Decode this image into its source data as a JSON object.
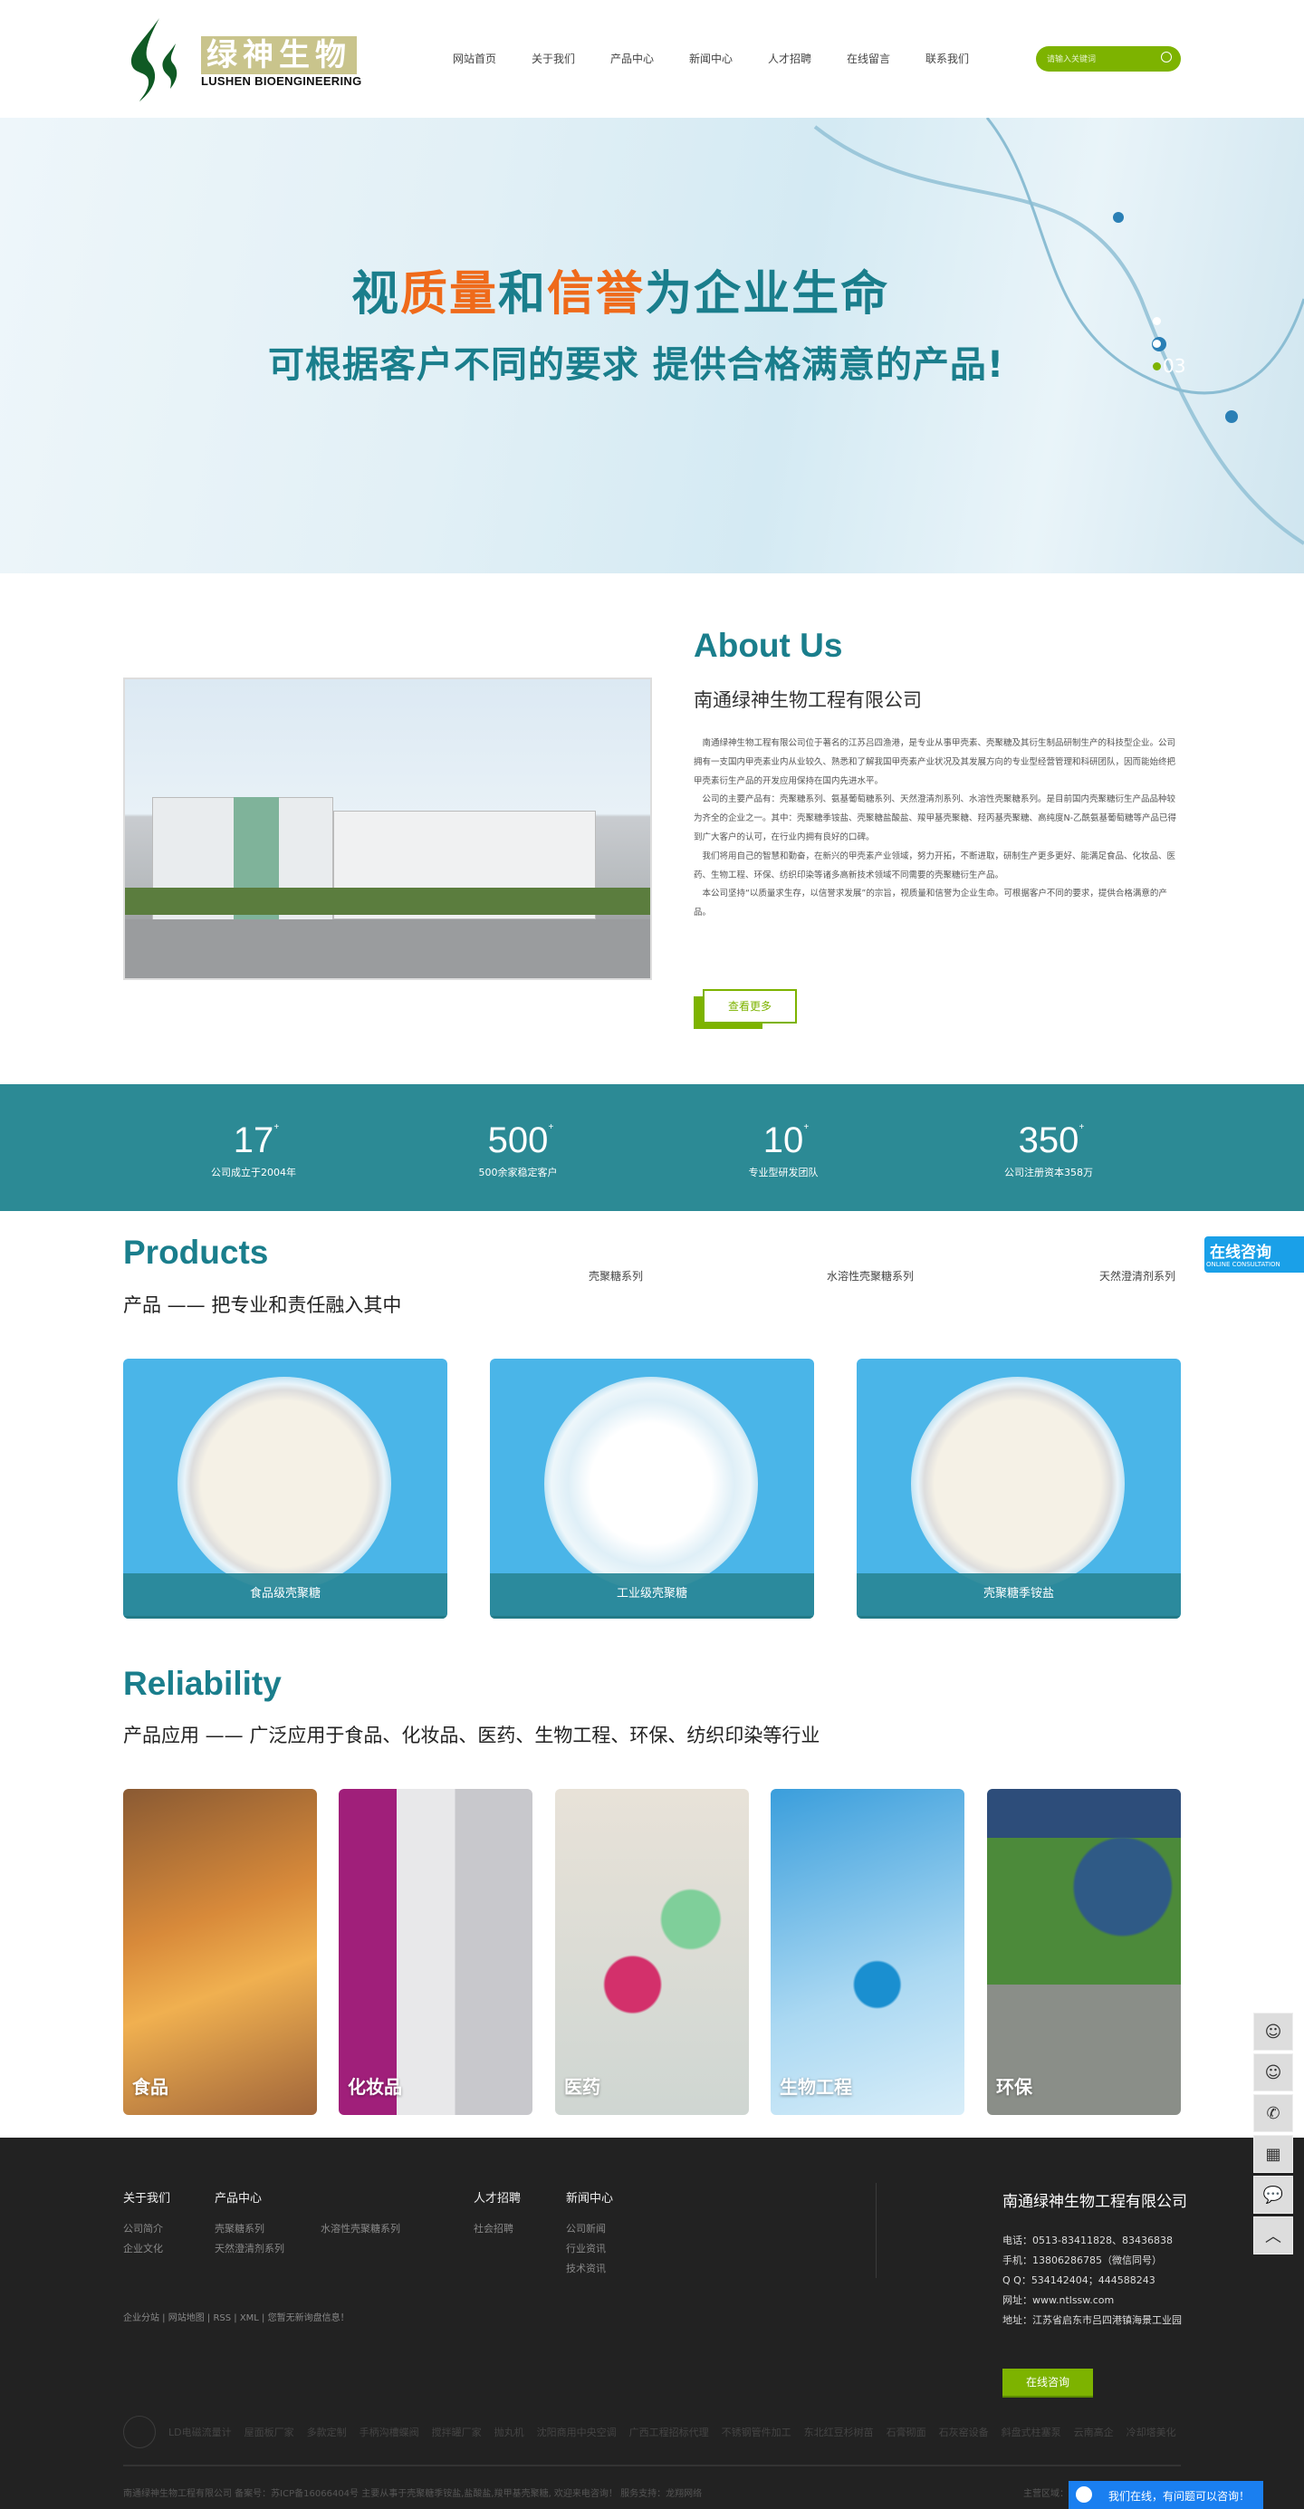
{
  "header": {
    "logo_cn": "绿神生物",
    "logo_en": "LUSHEN BIOENGINEERING",
    "nav": [
      "网站首页",
      "关于我们",
      "产品中心",
      "新闻中心",
      "人才招聘",
      "在线留言",
      "联系我们"
    ],
    "search_placeholder": "请输入关键词"
  },
  "banner": {
    "line1_parts": [
      "视",
      "质量",
      "和",
      "信誉",
      "为企业生命"
    ],
    "line2": "可根据客户不同的要求  提供合格满意的产品!",
    "page_indicator": "03",
    "accent": "#ef6a1a"
  },
  "about": {
    "title": "About Us",
    "company": "南通绿神生物工程有限公司",
    "paragraphs": [
      "南通绿神生物工程有限公司位于著名的江苏吕四渔港，是专业从事甲壳素、壳聚糖及其衍生制品研制生产的科技型企业。公司拥有一支国内甲壳素业内从业较久、熟悉和了解我国甲壳素产业状况及其发展方向的专业型经营管理和科研团队，因而能始终把甲壳素衍生产品的开发应用保持在国内先进水平。",
      "公司的主要产品有：壳聚糖系列、氨基葡萄糖系列、天然澄清剂系列、水溶性壳聚糖系列。是目前国内壳聚糖衍生产品品种较为齐全的企业之一。其中：壳聚糖季铵盐、壳聚糖盐酸盐、羧甲基壳聚糖、羟丙基壳聚糖、高纯度N-乙酰氨基葡萄糖等产品已得到广大客户的认可，在行业内拥有良好的口碑。",
      "我们将用自己的智慧和勤奋，在新兴的甲壳素产业领域，努力开拓，不断进取，研制生产更多更好、能满足食品、化妆品、医药、生物工程、环保、纺织印染等诸多高新技术领域不同需要的壳聚糖衍生产品。",
      "本公司坚持“以质量求生存，以信誉求发展”的宗旨，视质量和信誉为企业生命。可根据客户不同的要求，提供合格满意的产品。"
    ],
    "more_label": "查看更多"
  },
  "stats": [
    {
      "value": "17",
      "suffix": "+",
      "label": "公司成立于2004年"
    },
    {
      "value": "500",
      "suffix": "+",
      "label": "500余家稳定客户"
    },
    {
      "value": "10",
      "suffix": "+",
      "label": "专业型研发团队"
    },
    {
      "value": "350",
      "suffix": "+",
      "label": "公司注册资本358万"
    }
  ],
  "products": {
    "title": "Products",
    "subtitle": "产品 —— 把专业和责任融入其中",
    "tabs": [
      "壳聚糖系列",
      "水溶性壳聚糖系列",
      "天然澄清剂系列"
    ],
    "items": [
      "食品级壳聚糖",
      "工业级壳聚糖",
      "壳聚糖季铵盐"
    ]
  },
  "consult_badge": {
    "cn": "在线咨询",
    "en": "ONLINE CONSULTATION"
  },
  "reliability": {
    "title": "Reliability",
    "subtitle": "产品应用 —— 广泛应用于食品、化妆品、医药、生物工程、环保、纺织印染等行业",
    "items": [
      "食品",
      "化妆品",
      "医药",
      "生物工程",
      "环保"
    ]
  },
  "footer": {
    "columns": [
      {
        "title": "关于我们",
        "items": [
          "公司简介",
          "企业文化"
        ]
      },
      {
        "title": "产品中心",
        "items": [
          "壳聚糖系列",
          "天然澄清剂系列",
          "水溶性壳聚糖系列"
        ]
      },
      {
        "title": "人才招聘",
        "items": [
          "社会招聘"
        ]
      },
      {
        "title": "新闻中心",
        "items": [
          "公司新闻",
          "行业资讯",
          "技术资讯"
        ]
      }
    ],
    "bottom_links": "企业分站 | 网站地图 | RSS | XML | 您暂无新询盘信息！",
    "company": "南通绿神生物工程有限公司",
    "contact": [
      "电话：0513-83411828、83436838",
      "手机：13806286785（微信同号）",
      "Q Q：534142404；444588243",
      "网址：www.ntlssw.com",
      "地址：江苏省启东市吕四港镇海景工业园"
    ],
    "consult_button": "在线咨询",
    "friend_links": [
      "LD电磁流量计",
      "屋面板厂家",
      "多款定制",
      "手柄沟槽蝶阀",
      "搅拌罐厂家",
      "抛丸机",
      "沈阳商用中央空调",
      "广西工程招标代理",
      "不锈钢管件加工",
      "东北红豆杉树苗",
      "石膏砌面",
      "石灰窑设备",
      "斜盘式柱塞泵",
      "云南高企",
      "冷却塔美化"
    ],
    "copyright": "南通绿神生物工程有限公司 备案号：苏ICP备16066404号 主要从事于壳聚糖季铵盐,盐酸盐,羧甲基壳聚糖, 欢迎来电咨询！ 服务支持：龙翔网络",
    "region": "主营区域："
  },
  "chat_bar": "我们在线，有问题可以咨询！",
  "side_tools": [
    "qq-icon",
    "qq-icon",
    "phone-icon",
    "qrcode-icon",
    "message-icon",
    "back-to-top-icon"
  ]
}
